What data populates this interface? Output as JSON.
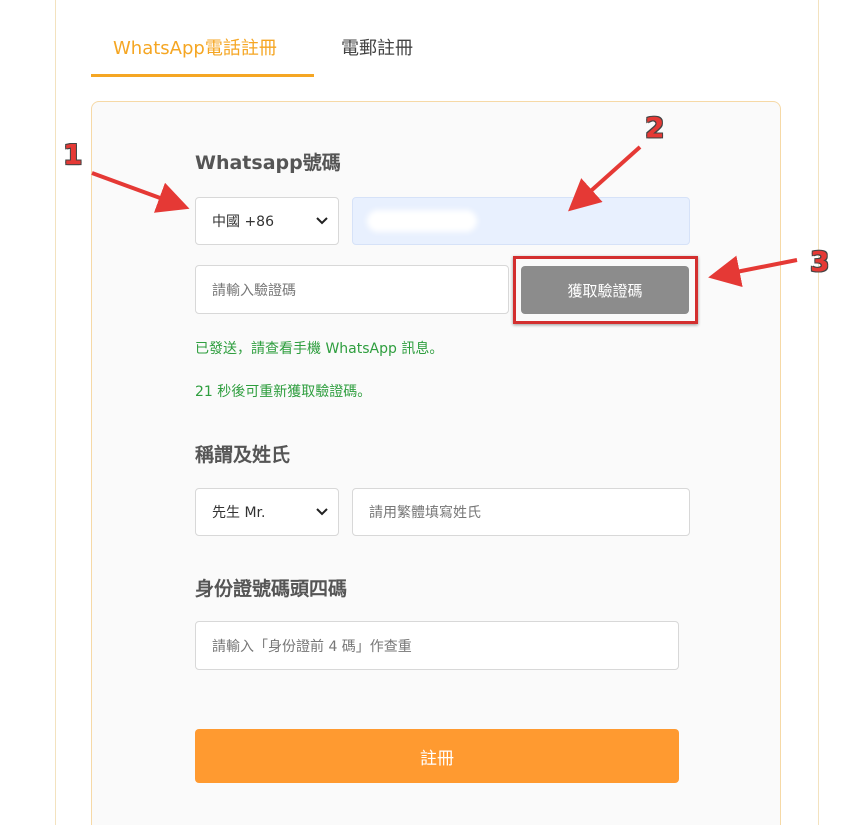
{
  "tabs": {
    "whatsapp_label": "WhatsApp電話註冊",
    "email_label": "電郵註冊"
  },
  "phone_section": {
    "label": "Whatsapp號碼",
    "country_select": "中國 +86",
    "code_placeholder": "請輸入驗證碼",
    "get_code_button": "獲取驗證碼",
    "sent_message": "已發送，請查看手機 WhatsApp 訊息。",
    "countdown_message": "21 秒後可重新獲取驗證碼。"
  },
  "name_section": {
    "label": "稱謂及姓氏",
    "title_select": "先生 Mr.",
    "surname_placeholder": "請用繁體填寫姓氏"
  },
  "id_section": {
    "label": "身份證號碼頭四碼",
    "id_placeholder": "請輸入「身份證前 4 碼」作查重"
  },
  "submit_label": "註冊",
  "annotations": {
    "one": "1",
    "two": "2",
    "three": "3"
  },
  "colors": {
    "accent": "#f5a623",
    "submit": "#ff9a30",
    "success_text": "#2e9e3e",
    "annotation_red": "#e53935",
    "button_gray": "#8c8c8c"
  },
  "icons": {
    "select_arrow": "chevron-down-icon"
  }
}
